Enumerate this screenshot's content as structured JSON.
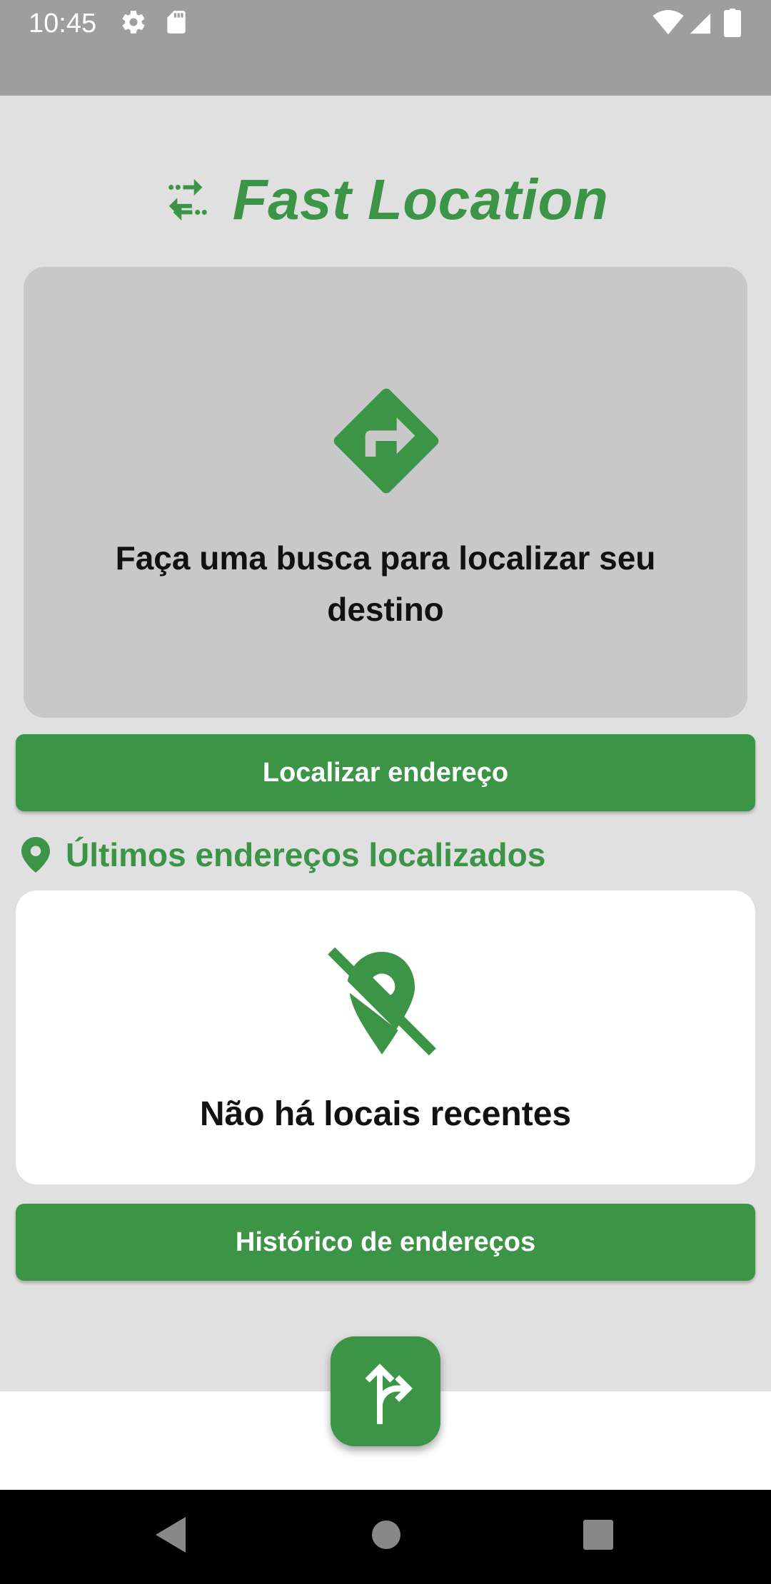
{
  "status_bar": {
    "time": "10:45",
    "icons": [
      "gear-icon",
      "sd-card-icon",
      "wifi-icon",
      "signal-icon",
      "battery-icon"
    ]
  },
  "header": {
    "title": "Fast Location",
    "icon": "swap-arrows-icon"
  },
  "search_card": {
    "icon": "directions-icon",
    "message": "Faça uma busca para localizar seu destino"
  },
  "buttons": {
    "locate_label": "Localizar endereço",
    "history_label": "Histórico de endereços"
  },
  "recent": {
    "section_icon": "location-pin-icon",
    "section_title": "Últimos endereços localizados",
    "empty_icon": "location-off-icon",
    "empty_message": "Não há locais recentes"
  },
  "fab": {
    "icon": "fork-right-icon"
  },
  "nav_bar": {
    "icons": [
      "back-icon",
      "home-icon",
      "recents-icon"
    ]
  },
  "colors": {
    "accent": "#3c9446",
    "background": "#e0e0e0",
    "status_bar": "#9e9e9e"
  }
}
